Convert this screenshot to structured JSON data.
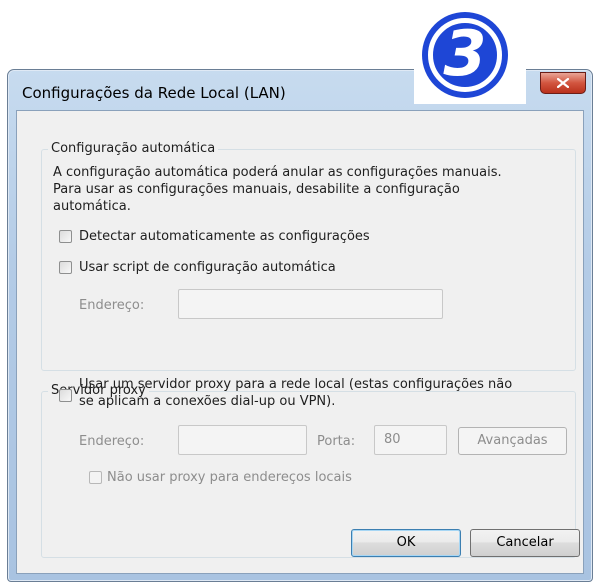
{
  "step_badge": "3",
  "dialog": {
    "title": "Configurações da Rede Local (LAN)",
    "close_label": "x"
  },
  "auto_config": {
    "legend": "Configuração automática",
    "description_line1": "A configuração automática poderá anular as configurações manuais.",
    "description_line2": "Para usar as configurações manuais, desabilite a configuração",
    "description_line3": "automática.",
    "detect_label": "Detectar automaticamente as configurações",
    "detect_checked": false,
    "script_label": "Usar script de configuração automática",
    "script_checked": false,
    "address_label": "Endereço:",
    "address_value": ""
  },
  "proxy": {
    "legend": "Servidor proxy",
    "use_proxy_line1": "Usar um servidor proxy para a rede local (estas configurações não",
    "use_proxy_line2": "se aplicam a conexões dial-up ou VPN).",
    "use_proxy_checked": false,
    "address_label": "Endereço:",
    "address_value": "",
    "port_label": "Porta:",
    "port_value": "80",
    "advanced_label": "Avançadas",
    "bypass_label": "Não usar proxy para endereços locais",
    "bypass_checked": false
  },
  "buttons": {
    "ok": "OK",
    "cancel": "Cancelar"
  }
}
